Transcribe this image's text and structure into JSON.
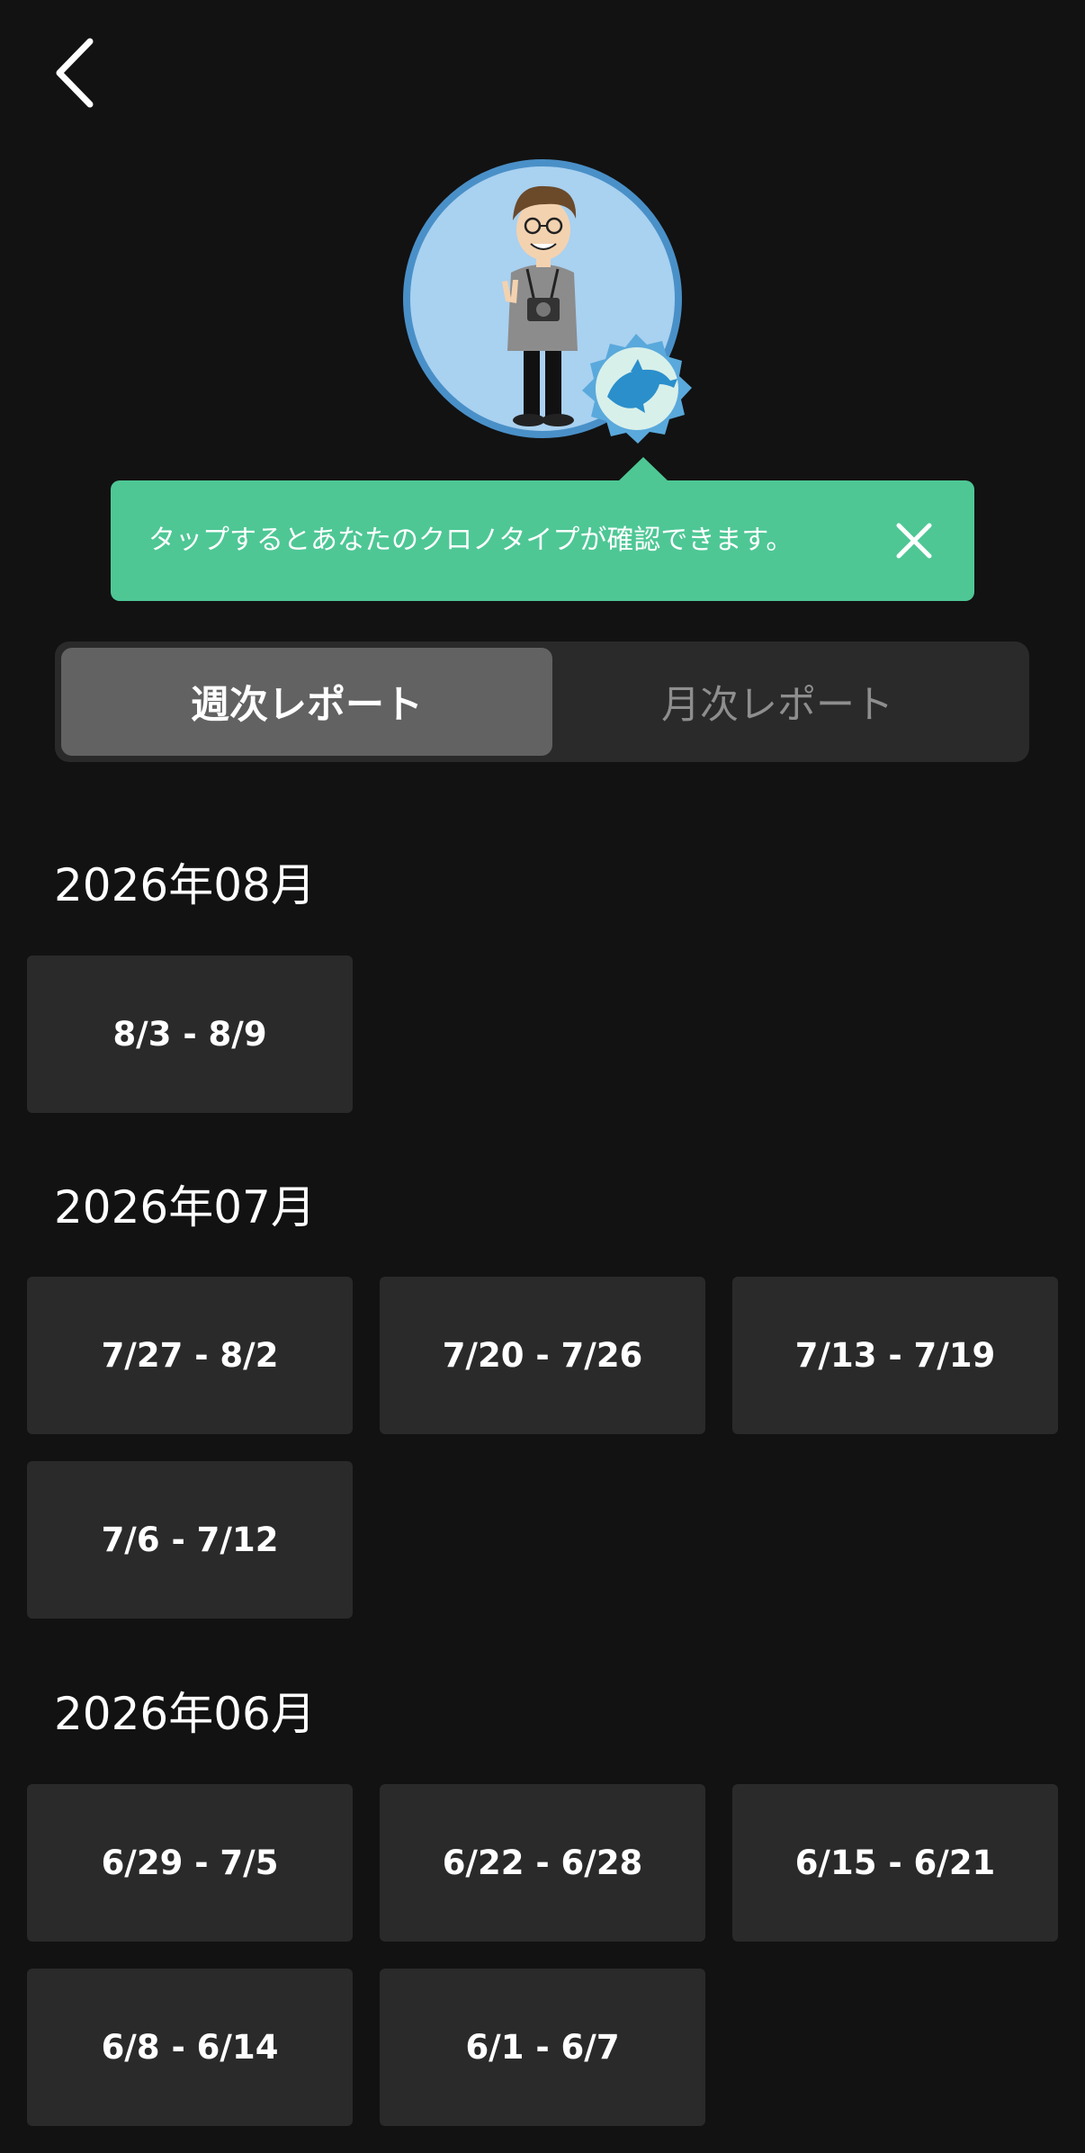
{
  "tooltip": {
    "message": "タップするとあなたのクロノタイプが確認できます。"
  },
  "tabs": {
    "weekly": "週次レポート",
    "monthly": "月次レポート"
  },
  "colors": {
    "background": "#121212",
    "tooltip": "#4ec795",
    "card": "#2a2a2a",
    "active_tab": "#626262",
    "avatar_ring": "#4a90c8"
  },
  "icons": {
    "back": "chevron-left-icon",
    "close": "close-icon",
    "badge": "dolphin-icon"
  },
  "sections": [
    {
      "heading": "2026年08月",
      "weeks": [
        "8/3 - 8/9"
      ]
    },
    {
      "heading": "2026年07月",
      "weeks": [
        "7/27 - 8/2",
        "7/20 - 7/26",
        "7/13 - 7/19",
        "7/6 - 7/12"
      ]
    },
    {
      "heading": "2026年06月",
      "weeks": [
        "6/29 - 7/5",
        "6/22 - 6/28",
        "6/15 - 6/21",
        "6/8 - 6/14",
        "6/1 - 6/7"
      ]
    }
  ]
}
